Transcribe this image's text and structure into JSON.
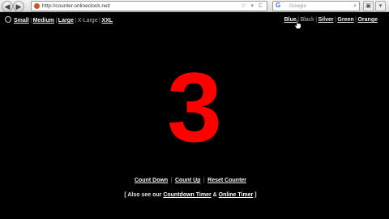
{
  "browser": {
    "url": "http://counter.onlineclock.net/",
    "search_placeholder": "Google",
    "back_glyph": "◀",
    "forward_glyph": "▶",
    "url_actions_glyph": "☆ ▾ C",
    "search_engine_glyph": "G",
    "magnifier_glyph": "⌕",
    "right_btn_glyphs": [
      "▣",
      "▾"
    ]
  },
  "size_options": {
    "items": [
      {
        "label": "Small",
        "type": "link"
      },
      {
        "label": "Medium",
        "type": "link"
      },
      {
        "label": "Large",
        "type": "link"
      },
      {
        "label": "X-Large",
        "type": "plain"
      },
      {
        "label": "XXL",
        "type": "link"
      }
    ],
    "separator": "|"
  },
  "color_options": {
    "items": [
      {
        "label": "Blue",
        "type": "link"
      },
      {
        "label": "Black",
        "type": "plain"
      },
      {
        "label": "Silver",
        "type": "link"
      },
      {
        "label": "Green",
        "type": "link"
      },
      {
        "label": "Orange",
        "type": "link"
      }
    ],
    "separator": "|"
  },
  "counter": {
    "value": "3",
    "color": "#ff0000"
  },
  "actions": {
    "count_down": "Count Down",
    "count_up": "Count Up",
    "reset": "Reset Counter",
    "separator": "|"
  },
  "also_see": {
    "prefix": "[ Also see our",
    "countdown": "Countdown Timer",
    "amp": "&",
    "online": "Online Timer",
    "suffix": "]"
  },
  "colors": {
    "background": "#000000",
    "counter": "#ff0000",
    "link": "#f3f3f3"
  }
}
